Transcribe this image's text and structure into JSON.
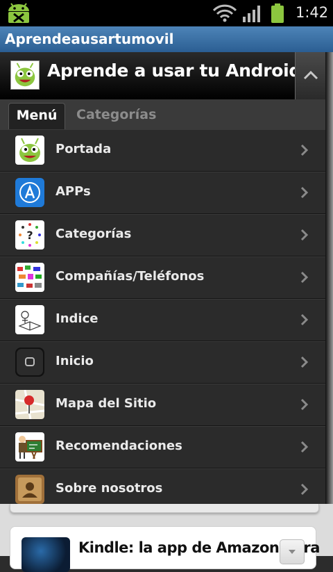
{
  "status_bar": {
    "time": "1:42"
  },
  "window": {
    "title": "Aprendeausartumovil"
  },
  "header": {
    "title": "Aprende a usar tu Android"
  },
  "tabs": [
    {
      "label": "Menú",
      "active": true
    },
    {
      "label": "Categorías",
      "active": false
    }
  ],
  "menu": {
    "items": [
      {
        "label": "Portada",
        "icon": "android-mascot-icon"
      },
      {
        "label": "APPs",
        "icon": "app-store-icon"
      },
      {
        "label": "Categorías",
        "icon": "question-dots-icon"
      },
      {
        "label": "Compañías/Teléfonos",
        "icon": "phones-collage-icon"
      },
      {
        "label": "Indice",
        "icon": "book-sketch-icon"
      },
      {
        "label": "Inicio",
        "icon": "home-button-icon"
      },
      {
        "label": "Mapa del Sitio",
        "icon": "map-pin-icon"
      },
      {
        "label": "Recomendaciones",
        "icon": "teacher-board-icon"
      },
      {
        "label": "Sobre nosotros",
        "icon": "contacts-book-icon"
      }
    ]
  },
  "article_card": {
    "title": "Kindle: la app de Amazon para"
  },
  "colors": {
    "titlebar": "#2b5e93",
    "list_bg": "#2b2b2b",
    "battery": "#8cc63f"
  }
}
